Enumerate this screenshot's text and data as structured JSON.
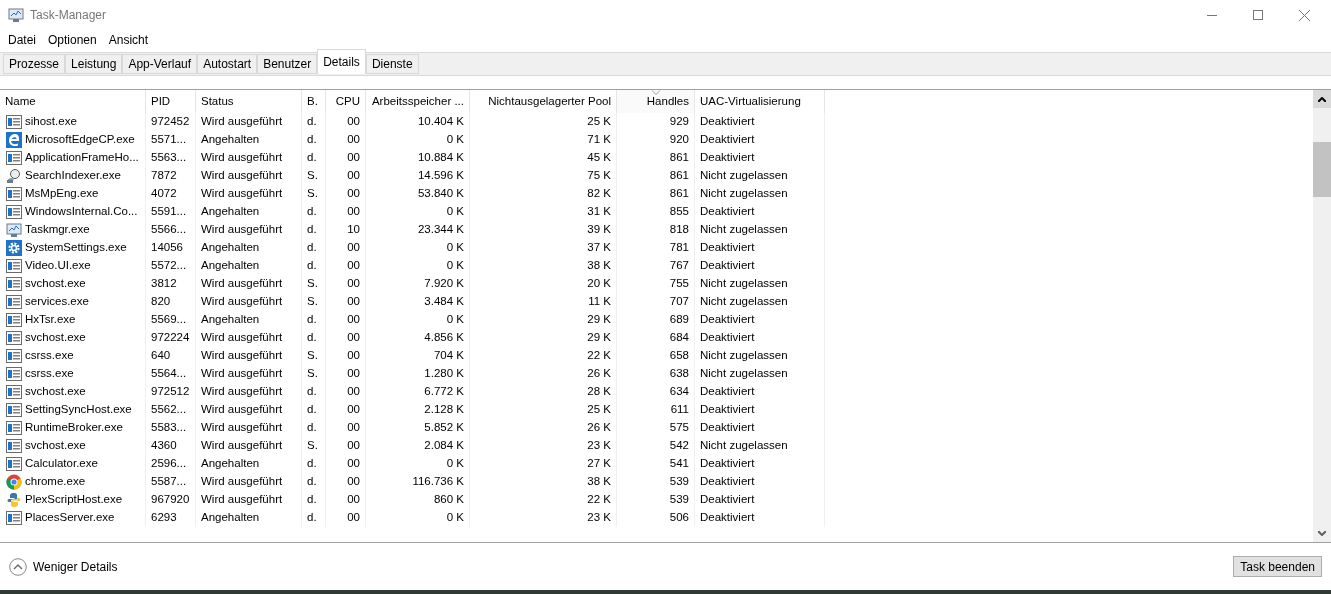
{
  "window": {
    "title": "Task-Manager"
  },
  "menu": [
    "Datei",
    "Optionen",
    "Ansicht"
  ],
  "tabs": [
    {
      "label": "Prozesse",
      "selected": false
    },
    {
      "label": "Leistung",
      "selected": false
    },
    {
      "label": "App-Verlauf",
      "selected": false
    },
    {
      "label": "Autostart",
      "selected": false
    },
    {
      "label": "Benutzer",
      "selected": false
    },
    {
      "label": "Details",
      "selected": true
    },
    {
      "label": "Dienste",
      "selected": false
    }
  ],
  "table": {
    "columns": [
      {
        "label": "Name",
        "sorted": false
      },
      {
        "label": "PID",
        "sorted": false
      },
      {
        "label": "Status",
        "sorted": false
      },
      {
        "label": "B.",
        "sorted": false
      },
      {
        "label": "CPU",
        "sorted": false
      },
      {
        "label": "Arbeitsspeicher ...",
        "sorted": false
      },
      {
        "label": "Nichtausgelagerter Pool",
        "sorted": false
      },
      {
        "label": "Handles",
        "sorted": true
      },
      {
        "label": "UAC-Virtualisierung",
        "sorted": false
      }
    ],
    "rows": [
      {
        "kind": "window",
        "cells": [
          "sihost.exe",
          "972452",
          "Wird ausgeführt",
          "d.",
          "00",
          "10.404 K",
          "25 K",
          "929",
          "Deaktiviert"
        ]
      },
      {
        "kind": "edge",
        "cells": [
          "MicrosoftEdgeCP.exe",
          "5571...",
          "Angehalten",
          "d.",
          "00",
          "0 K",
          "71 K",
          "920",
          "Deaktiviert"
        ]
      },
      {
        "kind": "window",
        "cells": [
          "ApplicationFrameHo...",
          "5563...",
          "Wird ausgeführt",
          "d.",
          "00",
          "10.884 K",
          "45 K",
          "861",
          "Deaktiviert"
        ]
      },
      {
        "kind": "search",
        "cells": [
          "SearchIndexer.exe",
          "7872",
          "Wird ausgeführt",
          "S.",
          "00",
          "14.596 K",
          "75 K",
          "861",
          "Nicht zugelassen"
        ]
      },
      {
        "kind": "window",
        "cells": [
          "MsMpEng.exe",
          "4072",
          "Wird ausgeführt",
          "S.",
          "00",
          "53.840 K",
          "82 K",
          "861",
          "Nicht zugelassen"
        ]
      },
      {
        "kind": "window",
        "cells": [
          "WindowsInternal.Co...",
          "5591...",
          "Angehalten",
          "d.",
          "00",
          "0 K",
          "31 K",
          "855",
          "Deaktiviert"
        ]
      },
      {
        "kind": "monitor",
        "cells": [
          "Taskmgr.exe",
          "5566...",
          "Wird ausgeführt",
          "d.",
          "10",
          "23.344 K",
          "39 K",
          "818",
          "Nicht zugelassen"
        ]
      },
      {
        "kind": "gear",
        "cells": [
          "SystemSettings.exe",
          "14056",
          "Angehalten",
          "d.",
          "00",
          "0 K",
          "37 K",
          "781",
          "Deaktiviert"
        ]
      },
      {
        "kind": "window",
        "cells": [
          "Video.UI.exe",
          "5572...",
          "Angehalten",
          "d.",
          "00",
          "0 K",
          "38 K",
          "767",
          "Deaktiviert"
        ]
      },
      {
        "kind": "window",
        "cells": [
          "svchost.exe",
          "3812",
          "Wird ausgeführt",
          "S.",
          "00",
          "7.920 K",
          "20 K",
          "755",
          "Nicht zugelassen"
        ]
      },
      {
        "kind": "window",
        "cells": [
          "services.exe",
          "820",
          "Wird ausgeführt",
          "S.",
          "00",
          "3.484 K",
          "11 K",
          "707",
          "Nicht zugelassen"
        ]
      },
      {
        "kind": "window",
        "cells": [
          "HxTsr.exe",
          "5569...",
          "Angehalten",
          "d.",
          "00",
          "0 K",
          "29 K",
          "689",
          "Deaktiviert"
        ]
      },
      {
        "kind": "window",
        "cells": [
          "svchost.exe",
          "972224",
          "Wird ausgeführt",
          "d.",
          "00",
          "4.856 K",
          "29 K",
          "684",
          "Deaktiviert"
        ]
      },
      {
        "kind": "window",
        "cells": [
          "csrss.exe",
          "640",
          "Wird ausgeführt",
          "S.",
          "00",
          "704 K",
          "22 K",
          "658",
          "Nicht zugelassen"
        ]
      },
      {
        "kind": "window",
        "cells": [
          "csrss.exe",
          "5564...",
          "Wird ausgeführt",
          "S.",
          "00",
          "1.280 K",
          "26 K",
          "638",
          "Nicht zugelassen"
        ]
      },
      {
        "kind": "window",
        "cells": [
          "svchost.exe",
          "972512",
          "Wird ausgeführt",
          "d.",
          "00",
          "6.772 K",
          "28 K",
          "634",
          "Deaktiviert"
        ]
      },
      {
        "kind": "window",
        "cells": [
          "SettingSyncHost.exe",
          "5562...",
          "Wird ausgeführt",
          "d.",
          "00",
          "2.128 K",
          "25 K",
          "611",
          "Deaktiviert"
        ]
      },
      {
        "kind": "window",
        "cells": [
          "RuntimeBroker.exe",
          "5583...",
          "Wird ausgeführt",
          "d.",
          "00",
          "5.852 K",
          "26 K",
          "575",
          "Deaktiviert"
        ]
      },
      {
        "kind": "window",
        "cells": [
          "svchost.exe",
          "4360",
          "Wird ausgeführt",
          "S.",
          "00",
          "2.084 K",
          "23 K",
          "542",
          "Nicht zugelassen"
        ]
      },
      {
        "kind": "window",
        "cells": [
          "Calculator.exe",
          "2596...",
          "Angehalten",
          "d.",
          "00",
          "0 K",
          "27 K",
          "541",
          "Deaktiviert"
        ]
      },
      {
        "kind": "chrome",
        "cells": [
          "chrome.exe",
          "5587...",
          "Wird ausgeführt",
          "d.",
          "00",
          "116.736 K",
          "38 K",
          "539",
          "Deaktiviert"
        ]
      },
      {
        "kind": "python",
        "cells": [
          "PlexScriptHost.exe",
          "967920",
          "Wird ausgeführt",
          "d.",
          "00",
          "860 K",
          "22 K",
          "539",
          "Deaktiviert"
        ]
      },
      {
        "kind": "window",
        "cells": [
          "PlacesServer.exe",
          "6293",
          "Angehalten",
          "d.",
          "00",
          "0 K",
          "23 K",
          "506",
          "Deaktiviert"
        ]
      }
    ]
  },
  "footer": {
    "toggle": "Weniger Details",
    "button": "Task beenden"
  }
}
